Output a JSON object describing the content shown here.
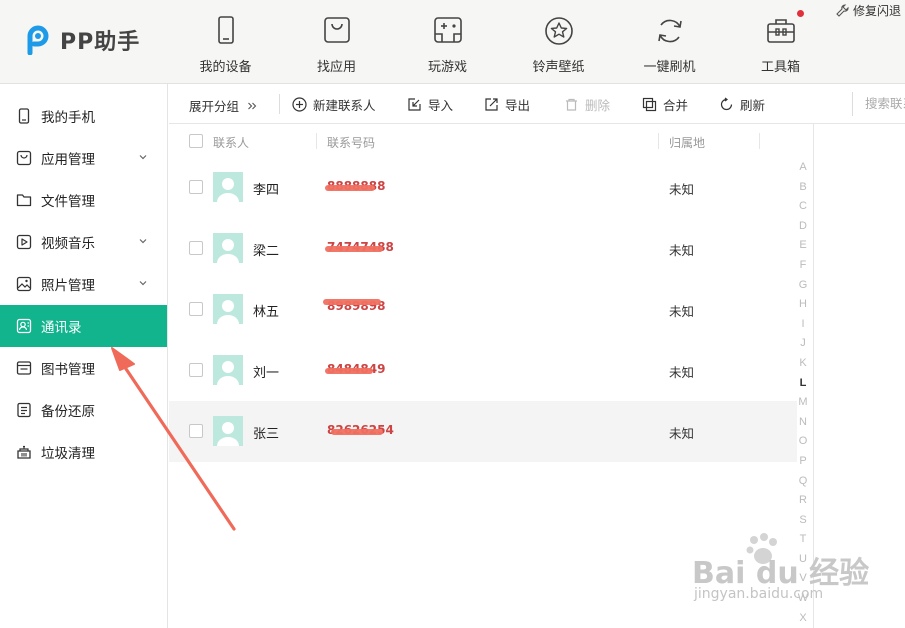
{
  "app": {
    "logo_text": "PP助手"
  },
  "nav": [
    {
      "label": "我的设备",
      "icon": "phone-icon"
    },
    {
      "label": "找应用",
      "icon": "bag-icon"
    },
    {
      "label": "玩游戏",
      "icon": "gamepad-icon"
    },
    {
      "label": "铃声壁纸",
      "icon": "star-icon"
    },
    {
      "label": "一键刷机",
      "icon": "refresh-icon"
    },
    {
      "label": "工具箱",
      "icon": "toolbox-icon"
    }
  ],
  "repair_label": "修复闪退",
  "sidebar": {
    "items": [
      {
        "label": "我的手机",
        "icon": "phone-icon",
        "has_chevron": false
      },
      {
        "label": "应用管理",
        "icon": "app-icon",
        "has_chevron": true
      },
      {
        "label": "文件管理",
        "icon": "folder-icon",
        "has_chevron": false
      },
      {
        "label": "视频音乐",
        "icon": "play-icon",
        "has_chevron": true
      },
      {
        "label": "照片管理",
        "icon": "photo-icon",
        "has_chevron": true
      },
      {
        "label": "通讯录",
        "icon": "contacts-icon",
        "has_chevron": false,
        "active": true
      },
      {
        "label": "图书管理",
        "icon": "book-icon",
        "has_chevron": false
      },
      {
        "label": "备份还原",
        "icon": "backup-icon",
        "has_chevron": false
      },
      {
        "label": "垃圾清理",
        "icon": "trash-icon",
        "has_chevron": false
      }
    ]
  },
  "toolbar": {
    "expand_group": "展开分组",
    "new_contact": "新建联系人",
    "import": "导入",
    "export": "导出",
    "delete": "删除",
    "merge": "合并",
    "refresh": "刷新",
    "search_placeholder": "搜索联系人"
  },
  "table": {
    "headers": {
      "name": "联系人",
      "phone": "联系号码",
      "location": "归属地"
    },
    "rows": [
      {
        "name": "李四",
        "phone": "8888888",
        "location": "未知"
      },
      {
        "name": "梁二",
        "phone": "74747488",
        "location": "未知"
      },
      {
        "name": "林五",
        "phone": "8989898",
        "location": "未知"
      },
      {
        "name": "刘一",
        "phone": "8484849",
        "location": "未知"
      },
      {
        "name": "张三",
        "phone": "82626254",
        "location": "未知"
      }
    ]
  },
  "alphabet": [
    "A",
    "B",
    "C",
    "D",
    "E",
    "F",
    "G",
    "H",
    "I",
    "J",
    "K",
    "L",
    "M",
    "N",
    "O",
    "P",
    "Q",
    "R",
    "S",
    "T",
    "U",
    "V",
    "W",
    "X"
  ],
  "alphabet_active": "L",
  "watermark": {
    "brand": "Bai du 经验",
    "url": "jingyan.baidu.com"
  },
  "colors": {
    "accent": "#12b48e",
    "logo_blue": "#1e9be8",
    "arrow": "#f06a5a"
  }
}
